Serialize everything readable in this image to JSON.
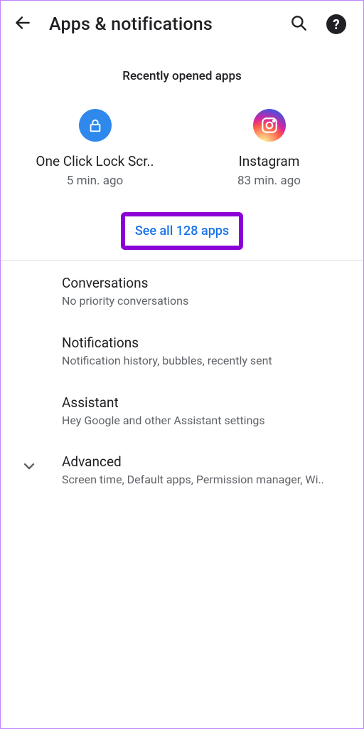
{
  "header": {
    "title": "Apps & notifications"
  },
  "recent": {
    "section_label": "Recently opened apps",
    "apps": [
      {
        "name": "One Click Lock Scr..",
        "time": "5 min. ago",
        "icon": "lock"
      },
      {
        "name": "Instagram",
        "time": "83 min. ago",
        "icon": "instagram"
      }
    ],
    "see_all": "See all 128 apps"
  },
  "settings": [
    {
      "title": "Conversations",
      "subtitle": "No priority conversations",
      "expandable": false
    },
    {
      "title": "Notifications",
      "subtitle": "Notification history, bubbles, recently sent",
      "expandable": false
    },
    {
      "title": "Assistant",
      "subtitle": "Hey Google and other Assistant settings",
      "expandable": false
    },
    {
      "title": "Advanced",
      "subtitle": "Screen time, Default apps, Permission manager, Wi..",
      "expandable": true
    }
  ]
}
